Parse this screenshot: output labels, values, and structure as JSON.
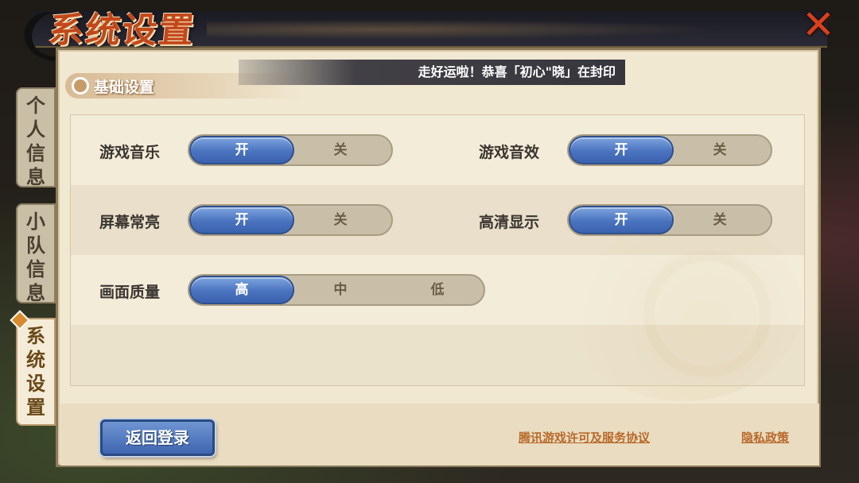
{
  "header": {
    "title": "系统设置",
    "close_icon": "close-icon"
  },
  "notice": "走好运啦！恭喜「初心\"晓」在封印",
  "section": {
    "title": "基础设置",
    "icon": "swirl-icon"
  },
  "tabs": [
    {
      "label": "个人信息",
      "active": false
    },
    {
      "label": "小队信息",
      "active": false
    },
    {
      "label": "系统设置",
      "active": true
    }
  ],
  "settings": {
    "game_music": {
      "label": "游戏音乐",
      "options": [
        "开",
        "关"
      ],
      "selected": "开"
    },
    "game_sfx": {
      "label": "游戏音效",
      "options": [
        "开",
        "关"
      ],
      "selected": "开"
    },
    "screen_on": {
      "label": "屏幕常亮",
      "options": [
        "开",
        "关"
      ],
      "selected": "开"
    },
    "hd_display": {
      "label": "高清显示",
      "options": [
        "开",
        "关"
      ],
      "selected": "开"
    },
    "quality": {
      "label": "画面质量",
      "options": [
        "高",
        "中",
        "低"
      ],
      "selected": "高"
    }
  },
  "footer": {
    "back_label": "返回登录",
    "license_link": "腾讯游戏许可及服务协议",
    "privacy_link": "隐私政策"
  },
  "colors": {
    "accent_blue": "#4a73bf",
    "title_red": "#c2481c",
    "panel_bg": "#f1e8d2",
    "link_orange": "#b8692a"
  }
}
